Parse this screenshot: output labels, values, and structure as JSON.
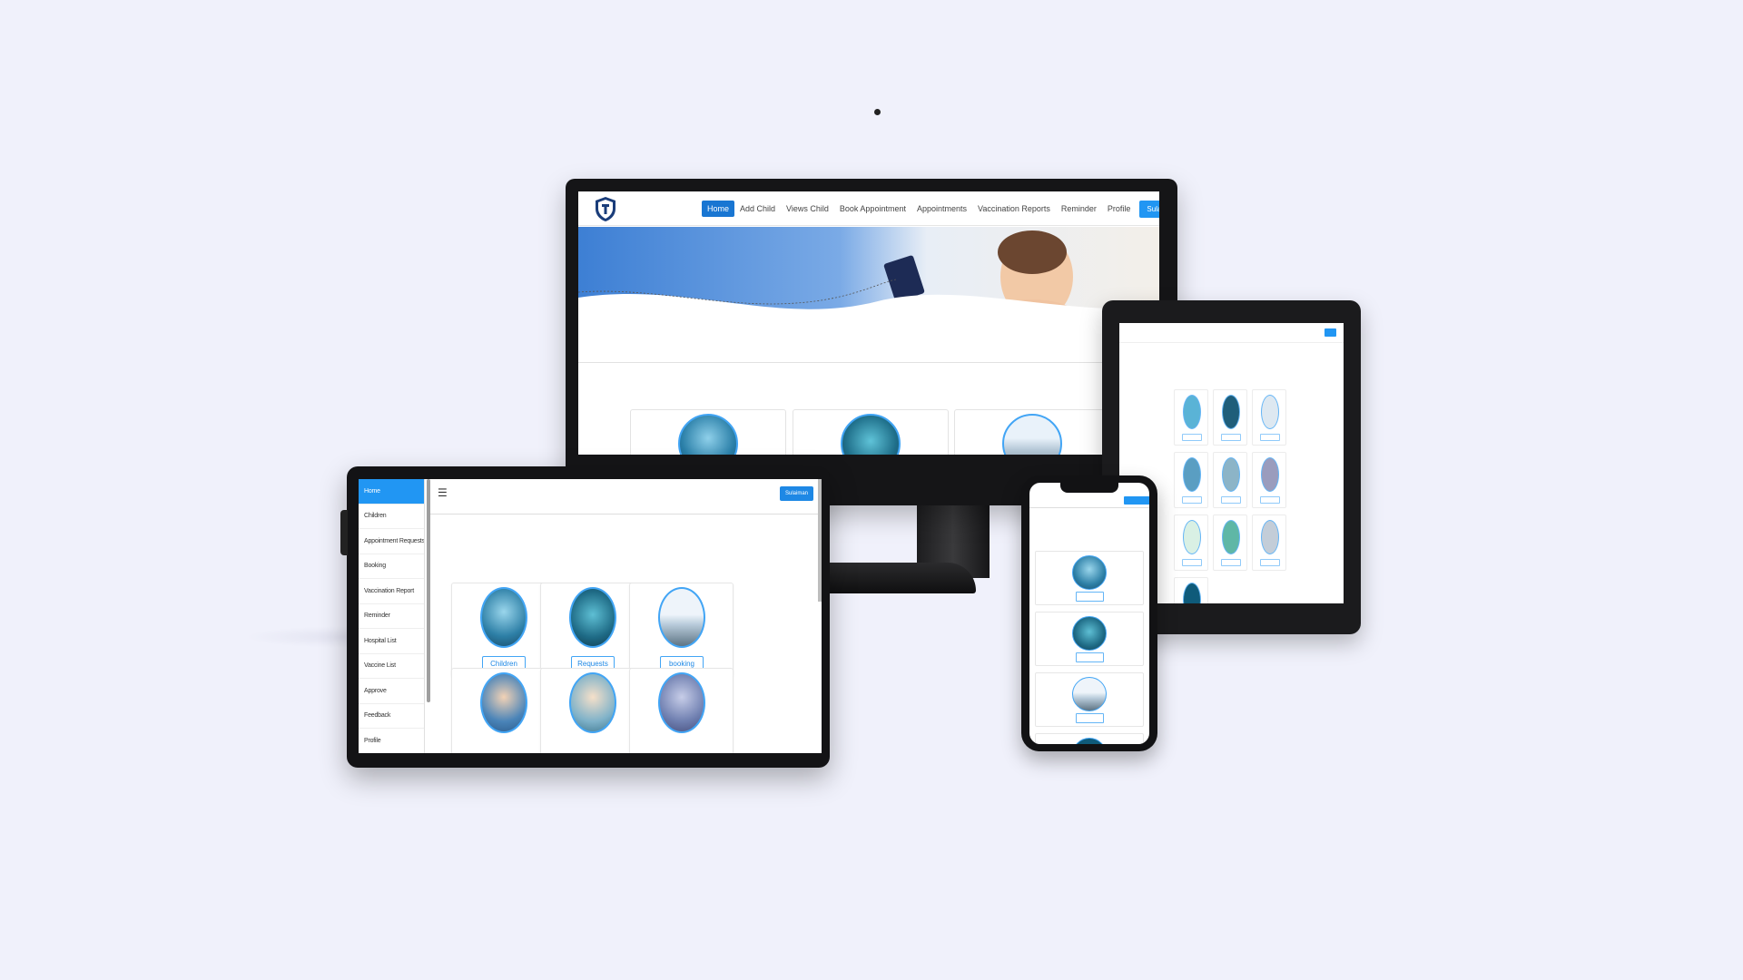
{
  "desktop": {
    "nav": {
      "links": [
        "Home",
        "Add Child",
        "Views Child",
        "Book Appointment",
        "Appointments",
        "Vaccination Reports",
        "Reminder",
        "Profile"
      ],
      "active": "Home",
      "user_label": "Sulaiman",
      "user_caret": "▾"
    }
  },
  "tablet_left": {
    "menu_icon": "☰",
    "user_label": "Sulaiman",
    "sidebar": [
      "Home",
      "Children",
      "Appointment Requests",
      "Booking",
      "Vaccination Report",
      "Reminder",
      "Hospital List",
      "Vaccine List",
      "Approve",
      "Feedback",
      "Profile"
    ],
    "cards": [
      "Children",
      "Requests",
      "booking"
    ]
  },
  "colors": {
    "page_bg": "#f0f1fb",
    "accent": "#2196f3",
    "nav_active": "#1976d2",
    "device": "#151517"
  },
  "icons": [
    "logo-shield-icon",
    "hamburger-menu-icon",
    "caret-down-icon"
  ]
}
